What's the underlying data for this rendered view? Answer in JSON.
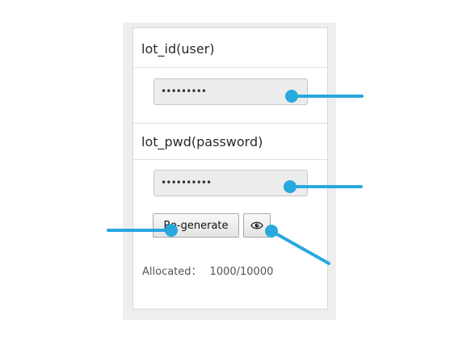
{
  "panel": {
    "user_label": "lot_id(user)",
    "user_value": "•••••••••",
    "pwd_label": "lot_pwd(password)",
    "pwd_value": "••••••••••",
    "regenerate_label": "Re-generate",
    "show_icon": "eye-icon",
    "allocated_label": "Allocated：",
    "allocated_value": "1000/10000"
  },
  "colors": {
    "callout": "#29a8dd",
    "panel_border": "#d8d8d8",
    "frame_bg": "#eeeeee"
  }
}
